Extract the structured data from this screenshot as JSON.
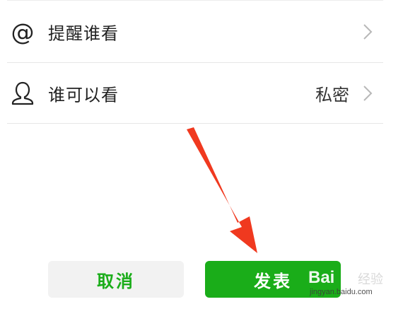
{
  "settings": {
    "items": [
      {
        "icon": "at-sign-icon",
        "icon_glyph": "@",
        "label": "提醒谁看",
        "value": ""
      },
      {
        "icon": "user-icon",
        "label": "谁可以看",
        "value": "私密"
      }
    ]
  },
  "actions": {
    "cancel_label": "取消",
    "publish_label": "发表"
  },
  "annotation": {
    "arrow_color": "#f0391f"
  },
  "watermark": {
    "brand": "Bai",
    "suffix": "经验",
    "url": "jingyan.baidu.com"
  },
  "colors": {
    "accent_green": "#1aad19",
    "cancel_bg": "#f2f2f2"
  }
}
